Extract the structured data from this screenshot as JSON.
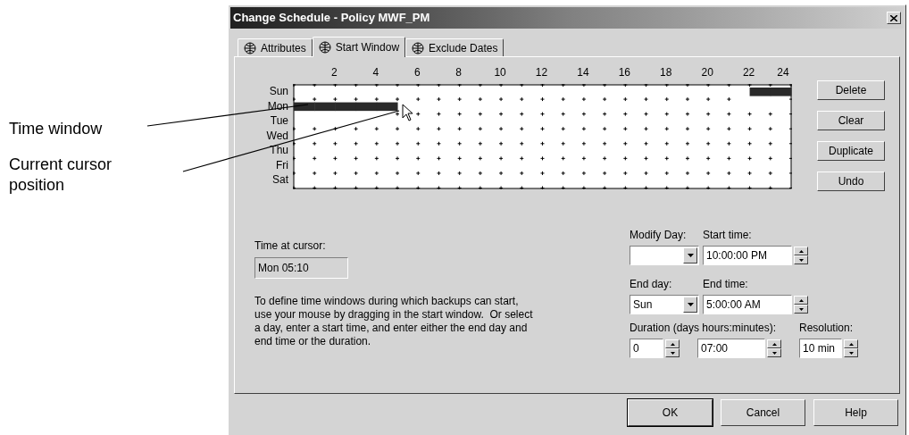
{
  "callouts": [
    {
      "text": "Time window"
    },
    {
      "text": "Current cursor position"
    }
  ],
  "window": {
    "title": "Change Schedule - Policy MWF_PM"
  },
  "tabs": [
    {
      "label": "Attributes",
      "selected": false
    },
    {
      "label": "Start Window",
      "selected": true
    },
    {
      "label": "Exclude Dates",
      "selected": false
    }
  ],
  "schedule": {
    "hours": [
      "2",
      "4",
      "6",
      "8",
      "10",
      "12",
      "14",
      "16",
      "18",
      "20",
      "22",
      "24"
    ],
    "days": [
      {
        "label": "Sun",
        "slots": [
          false,
          false,
          false,
          false,
          false,
          false,
          false,
          false,
          false,
          false,
          false,
          false,
          false,
          false,
          false,
          false,
          false,
          false,
          false,
          false,
          false,
          false,
          true,
          true
        ]
      },
      {
        "label": "Mon",
        "slots": [
          true,
          true,
          true,
          true,
          true,
          false,
          false,
          false,
          false,
          false,
          false,
          false,
          false,
          false,
          false,
          false,
          false,
          false,
          false,
          false,
          false,
          false,
          false,
          false
        ]
      },
      {
        "label": "Tue",
        "slots": [
          false,
          false,
          false,
          false,
          false,
          false,
          false,
          false,
          false,
          false,
          false,
          false,
          false,
          false,
          false,
          false,
          false,
          false,
          false,
          false,
          false,
          false,
          false,
          false
        ]
      },
      {
        "label": "Wed",
        "slots": [
          false,
          false,
          false,
          false,
          false,
          false,
          false,
          false,
          false,
          false,
          false,
          false,
          false,
          false,
          false,
          false,
          false,
          false,
          false,
          false,
          false,
          false,
          false,
          false
        ]
      },
      {
        "label": "Thu",
        "slots": [
          false,
          false,
          false,
          false,
          false,
          false,
          false,
          false,
          false,
          false,
          false,
          false,
          false,
          false,
          false,
          false,
          false,
          false,
          false,
          false,
          false,
          false,
          false,
          false
        ]
      },
      {
        "label": "Fri",
        "slots": [
          false,
          false,
          false,
          false,
          false,
          false,
          false,
          false,
          false,
          false,
          false,
          false,
          false,
          false,
          false,
          false,
          false,
          false,
          false,
          false,
          false,
          false,
          false,
          false
        ]
      },
      {
        "label": "Sat",
        "slots": [
          false,
          false,
          false,
          false,
          false,
          false,
          false,
          false,
          false,
          false,
          false,
          false,
          false,
          false,
          false,
          false,
          false,
          false,
          false,
          false,
          false,
          false,
          false,
          false
        ]
      }
    ]
  },
  "side_buttons": [
    "Delete",
    "Clear",
    "Duplicate",
    "Undo"
  ],
  "time_at_cursor": {
    "label": "Time at cursor:",
    "value": "Mon 05:10"
  },
  "instructions": "To define time windows during which backups can start, use your mouse by dragging in the start window.  Or select a day, enter a start time, and enter either the end day and end time or the duration.",
  "modify_day": {
    "label": "Modify Day:"
  },
  "start_time": {
    "label": "Start time:",
    "value": "10:00:00 PM"
  },
  "end_day": {
    "label": "End day:",
    "value": "Sun"
  },
  "end_time": {
    "label": "End time:",
    "value": "5:00:00 AM"
  },
  "duration": {
    "label": "Duration (days hours:minutes):",
    "days": "0",
    "time": "07:00"
  },
  "resolution": {
    "label": "Resolution:",
    "value": "10 min"
  },
  "buttons": [
    {
      "label": "OK",
      "default": true
    },
    {
      "label": "Cancel",
      "default": false
    },
    {
      "label": "Help",
      "default": false
    }
  ]
}
